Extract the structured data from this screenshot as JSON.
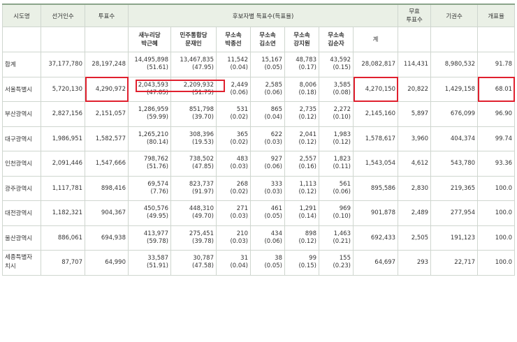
{
  "headers": {
    "region": "시도명",
    "electors": "선거인수",
    "voters": "투표수",
    "candidates_group": "후보자별 득표수(득표율)",
    "invalid": "무효\n투표수",
    "abstain": "기권수",
    "turnout": "개표율",
    "candidates": [
      {
        "party": "새누리당",
        "name": "박근혜"
      },
      {
        "party": "민주통합당",
        "name": "문재인"
      },
      {
        "party": "무소속",
        "name": "박종선"
      },
      {
        "party": "무소속",
        "name": "김소연"
      },
      {
        "party": "무소속",
        "name": "강지원"
      },
      {
        "party": "무소속",
        "name": "김순자"
      }
    ],
    "total": "계"
  },
  "rows": [
    {
      "region": "합계",
      "electors": "37,177,780",
      "voters": "28,197,248",
      "c": [
        [
          "14,495,898",
          "(51.61)"
        ],
        [
          "13,467,835",
          "(47.95)"
        ],
        [
          "11,542",
          "(0.04)"
        ],
        [
          "15,167",
          "(0.05)"
        ],
        [
          "48,783",
          "(0.17)"
        ],
        [
          "43,592",
          "(0.15)"
        ]
      ],
      "total": "28,082,817",
      "invalid": "114,431",
      "abstain": "8,980,532",
      "turnout": "91.78"
    },
    {
      "region": "서울특별시",
      "electors": "5,720,130",
      "voters": "4,290,972",
      "c": [
        [
          "2,043,593",
          "(47.85)"
        ],
        [
          "2,209,932",
          "(51.75)"
        ],
        [
          "2,449",
          "(0.06)"
        ],
        [
          "2,585",
          "(0.06)"
        ],
        [
          "8,006",
          "(0.18)"
        ],
        [
          "3,585",
          "(0.08)"
        ]
      ],
      "total": "4,270,150",
      "invalid": "20,822",
      "abstain": "1,429,158",
      "turnout": "68.01"
    },
    {
      "region": "부산광역시",
      "electors": "2,827,156",
      "voters": "2,151,057",
      "c": [
        [
          "1,286,959",
          "(59.99)"
        ],
        [
          "851,798",
          "(39.70)"
        ],
        [
          "531",
          "(0.02)"
        ],
        [
          "865",
          "(0.04)"
        ],
        [
          "2,735",
          "(0.12)"
        ],
        [
          "2,272",
          "(0.10)"
        ]
      ],
      "total": "2,145,160",
      "invalid": "5,897",
      "abstain": "676,099",
      "turnout": "96.90"
    },
    {
      "region": "대구광역시",
      "electors": "1,986,951",
      "voters": "1,582,577",
      "c": [
        [
          "1,265,210",
          "(80.14)"
        ],
        [
          "308,396",
          "(19.53)"
        ],
        [
          "365",
          "(0.02)"
        ],
        [
          "622",
          "(0.03)"
        ],
        [
          "2,041",
          "(0.12)"
        ],
        [
          "1,983",
          "(0.12)"
        ]
      ],
      "total": "1,578,617",
      "invalid": "3,960",
      "abstain": "404,374",
      "turnout": "99.74"
    },
    {
      "region": "인천광역시",
      "electors": "2,091,446",
      "voters": "1,547,666",
      "c": [
        [
          "798,762",
          "(51.76)"
        ],
        [
          "738,502",
          "(47.85)"
        ],
        [
          "483",
          "(0.03)"
        ],
        [
          "927",
          "(0.06)"
        ],
        [
          "2,557",
          "(0.16)"
        ],
        [
          "1,823",
          "(0.11)"
        ]
      ],
      "total": "1,543,054",
      "invalid": "4,612",
      "abstain": "543,780",
      "turnout": "93.36"
    },
    {
      "region": "광주광역시",
      "electors": "1,117,781",
      "voters": "898,416",
      "c": [
        [
          "69,574",
          "(7.76)"
        ],
        [
          "823,737",
          "(91.97)"
        ],
        [
          "268",
          "(0.02)"
        ],
        [
          "333",
          "(0.03)"
        ],
        [
          "1,113",
          "(0.12)"
        ],
        [
          "561",
          "(0.06)"
        ]
      ],
      "total": "895,586",
      "invalid": "2,830",
      "abstain": "219,365",
      "turnout": "100.0"
    },
    {
      "region": "대전광역시",
      "electors": "1,182,321",
      "voters": "904,367",
      "c": [
        [
          "450,576",
          "(49.95)"
        ],
        [
          "448,310",
          "(49.70)"
        ],
        [
          "271",
          "(0.03)"
        ],
        [
          "461",
          "(0.05)"
        ],
        [
          "1,291",
          "(0.14)"
        ],
        [
          "969",
          "(0.10)"
        ]
      ],
      "total": "901,878",
      "invalid": "2,489",
      "abstain": "277,954",
      "turnout": "100.0"
    },
    {
      "region": "울산광역시",
      "electors": "886,061",
      "voters": "694,938",
      "c": [
        [
          "413,977",
          "(59.78)"
        ],
        [
          "275,451",
          "(39.78)"
        ],
        [
          "210",
          "(0.03)"
        ],
        [
          "434",
          "(0.06)"
        ],
        [
          "898",
          "(0.12)"
        ],
        [
          "1,463",
          "(0.21)"
        ]
      ],
      "total": "692,433",
      "invalid": "2,505",
      "abstain": "191,123",
      "turnout": "100.0"
    },
    {
      "region": "세종특별자\n치시",
      "electors": "87,707",
      "voters": "64,990",
      "c": [
        [
          "33,587",
          "(51.91)"
        ],
        [
          "30,787",
          "(47.58)"
        ],
        [
          "31",
          "(0.04)"
        ],
        [
          "38",
          "(0.05)"
        ],
        [
          "99",
          "(0.15)"
        ],
        [
          "155",
          "(0.23)"
        ]
      ],
      "total": "64,697",
      "invalid": "293",
      "abstain": "22,717",
      "turnout": "100.0"
    }
  ]
}
